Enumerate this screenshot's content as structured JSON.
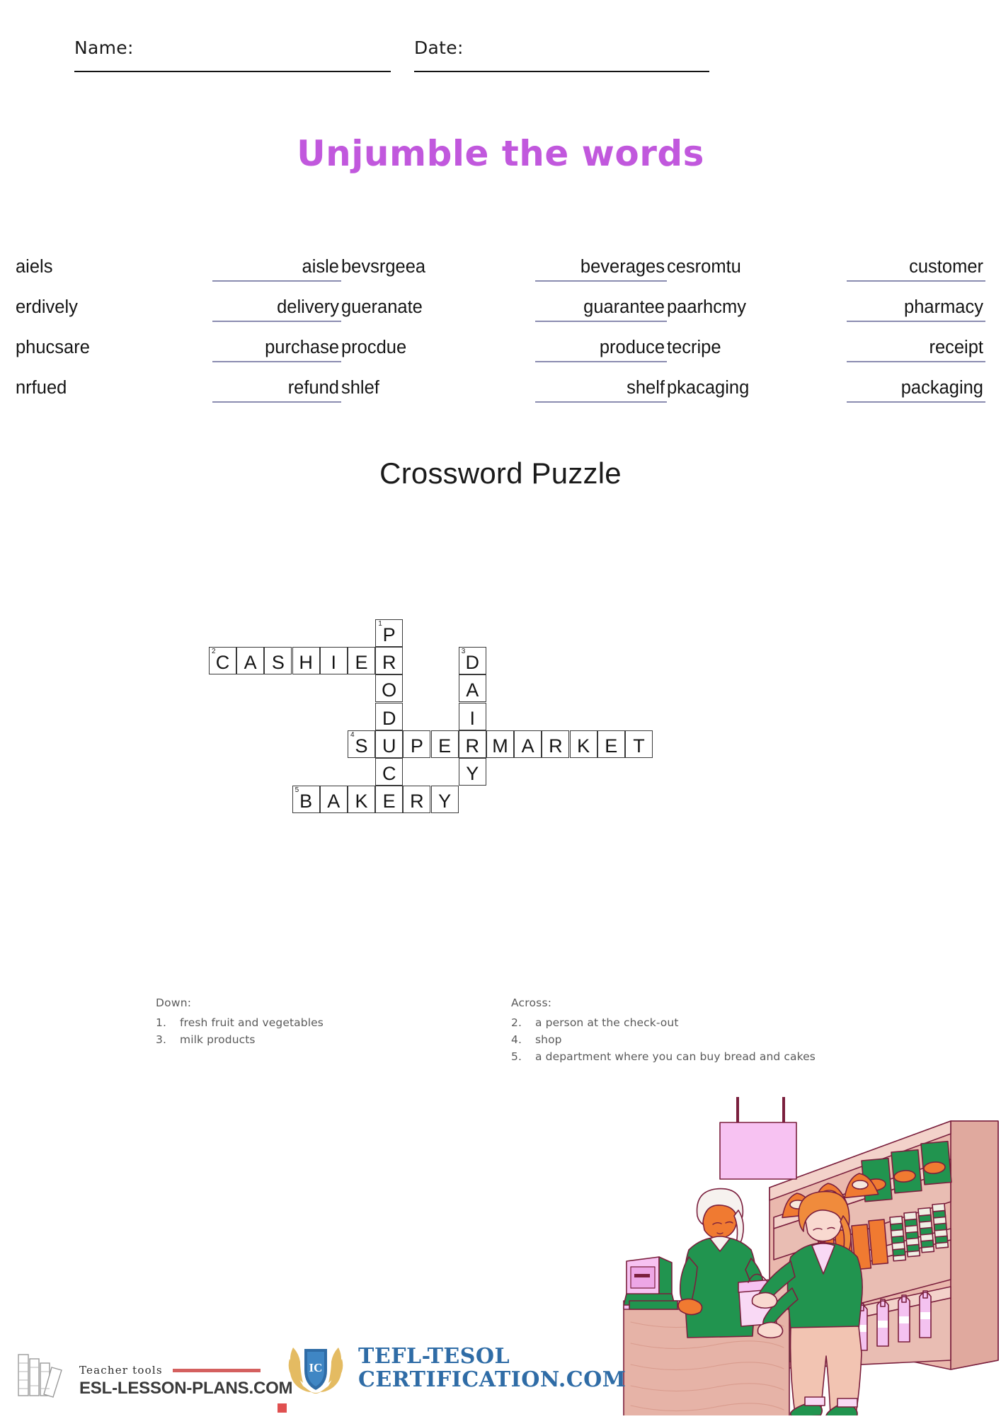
{
  "header": {
    "name_label": "Name:",
    "date_label": "Date:"
  },
  "title": "Unjumble the words",
  "title_color": "#c158dd",
  "unjumble": {
    "pairs": [
      {
        "jumble": "aiels",
        "answer": "aisle"
      },
      {
        "jumble": "bevsrgeea",
        "answer": "beverages"
      },
      {
        "jumble": "cesromtu",
        "answer": "customer"
      },
      {
        "jumble": "erdively",
        "answer": "delivery"
      },
      {
        "jumble": "gueranate",
        "answer": "guarantee"
      },
      {
        "jumble": "paarhcmy",
        "answer": "pharmacy"
      },
      {
        "jumble": "phucsare",
        "answer": "purchase"
      },
      {
        "jumble": "procdue",
        "answer": "produce"
      },
      {
        "jumble": "tecripe",
        "answer": "receipt"
      },
      {
        "jumble": "nrfued",
        "answer": "refund"
      },
      {
        "jumble": "shlef",
        "answer": "shelf"
      },
      {
        "jumble": "pkacaging",
        "answer": "packaging"
      }
    ]
  },
  "crossword": {
    "heading": "Crossword Puzzle",
    "entries": [
      {
        "number": "1",
        "direction": "down",
        "answer": "PRODUCE",
        "row": 0,
        "col": 6
      },
      {
        "number": "2",
        "direction": "across",
        "answer": "CASHIER",
        "row": 1,
        "col": 0
      },
      {
        "number": "3",
        "direction": "down",
        "answer": "DAIRY",
        "row": 1,
        "col": 9
      },
      {
        "number": "4",
        "direction": "across",
        "answer": "SUPERMARKET",
        "row": 4,
        "col": 5
      },
      {
        "number": "5",
        "direction": "across",
        "answer": "BAKERY",
        "row": 6,
        "col": 3
      }
    ],
    "cells": [
      {
        "r": 0,
        "c": 6,
        "letter": "P",
        "num": "1"
      },
      {
        "r": 1,
        "c": 0,
        "letter": "C",
        "num": "2"
      },
      {
        "r": 1,
        "c": 1,
        "letter": "A",
        "num": ""
      },
      {
        "r": 1,
        "c": 2,
        "letter": "S",
        "num": ""
      },
      {
        "r": 1,
        "c": 3,
        "letter": "H",
        "num": ""
      },
      {
        "r": 1,
        "c": 4,
        "letter": "I",
        "num": ""
      },
      {
        "r": 1,
        "c": 5,
        "letter": "E",
        "num": ""
      },
      {
        "r": 1,
        "c": 6,
        "letter": "R",
        "num": ""
      },
      {
        "r": 1,
        "c": 9,
        "letter": "D",
        "num": "3"
      },
      {
        "r": 2,
        "c": 6,
        "letter": "O",
        "num": ""
      },
      {
        "r": 2,
        "c": 9,
        "letter": "A",
        "num": ""
      },
      {
        "r": 3,
        "c": 6,
        "letter": "D",
        "num": ""
      },
      {
        "r": 3,
        "c": 9,
        "letter": "I",
        "num": ""
      },
      {
        "r": 4,
        "c": 5,
        "letter": "S",
        "num": "4"
      },
      {
        "r": 4,
        "c": 6,
        "letter": "U",
        "num": ""
      },
      {
        "r": 4,
        "c": 7,
        "letter": "P",
        "num": ""
      },
      {
        "r": 4,
        "c": 8,
        "letter": "E",
        "num": ""
      },
      {
        "r": 4,
        "c": 9,
        "letter": "R",
        "num": ""
      },
      {
        "r": 4,
        "c": 10,
        "letter": "M",
        "num": ""
      },
      {
        "r": 4,
        "c": 11,
        "letter": "A",
        "num": ""
      },
      {
        "r": 4,
        "c": 12,
        "letter": "R",
        "num": ""
      },
      {
        "r": 4,
        "c": 13,
        "letter": "K",
        "num": ""
      },
      {
        "r": 4,
        "c": 14,
        "letter": "E",
        "num": ""
      },
      {
        "r": 4,
        "c": 15,
        "letter": "T",
        "num": ""
      },
      {
        "r": 5,
        "c": 6,
        "letter": "C",
        "num": ""
      },
      {
        "r": 5,
        "c": 9,
        "letter": "Y",
        "num": ""
      },
      {
        "r": 6,
        "c": 3,
        "letter": "B",
        "num": "5"
      },
      {
        "r": 6,
        "c": 4,
        "letter": "A",
        "num": ""
      },
      {
        "r": 6,
        "c": 5,
        "letter": "K",
        "num": ""
      },
      {
        "r": 6,
        "c": 6,
        "letter": "E",
        "num": ""
      },
      {
        "r": 6,
        "c": 7,
        "letter": "R",
        "num": ""
      },
      {
        "r": 6,
        "c": 8,
        "letter": "Y",
        "num": ""
      }
    ]
  },
  "clues": {
    "down_heading": "Down:",
    "down": [
      {
        "no": "1.",
        "text": "fresh fruit and vegetables"
      },
      {
        "no": "3.",
        "text": "milk products"
      }
    ],
    "across_heading": "Across:",
    "across": [
      {
        "no": "2.",
        "text": "a person at the check-out"
      },
      {
        "no": "4.",
        "text": "shop"
      },
      {
        "no": "5.",
        "text": "a department where you can buy bread and cakes"
      }
    ]
  },
  "footer": {
    "esl": {
      "tagline": "Teacher tools",
      "domain": "ESL-LESSON-PLANS.COM"
    },
    "tefl": {
      "badge_text": "IC",
      "line1": "TEFL-TESOL",
      "line2": "CERTIFICATION.COM"
    }
  },
  "illustration": {
    "name": "supermarket-checkout-scene",
    "description": "cashier handing a shopping bag to a customer at a supermarket checkout with stocked shelves"
  }
}
